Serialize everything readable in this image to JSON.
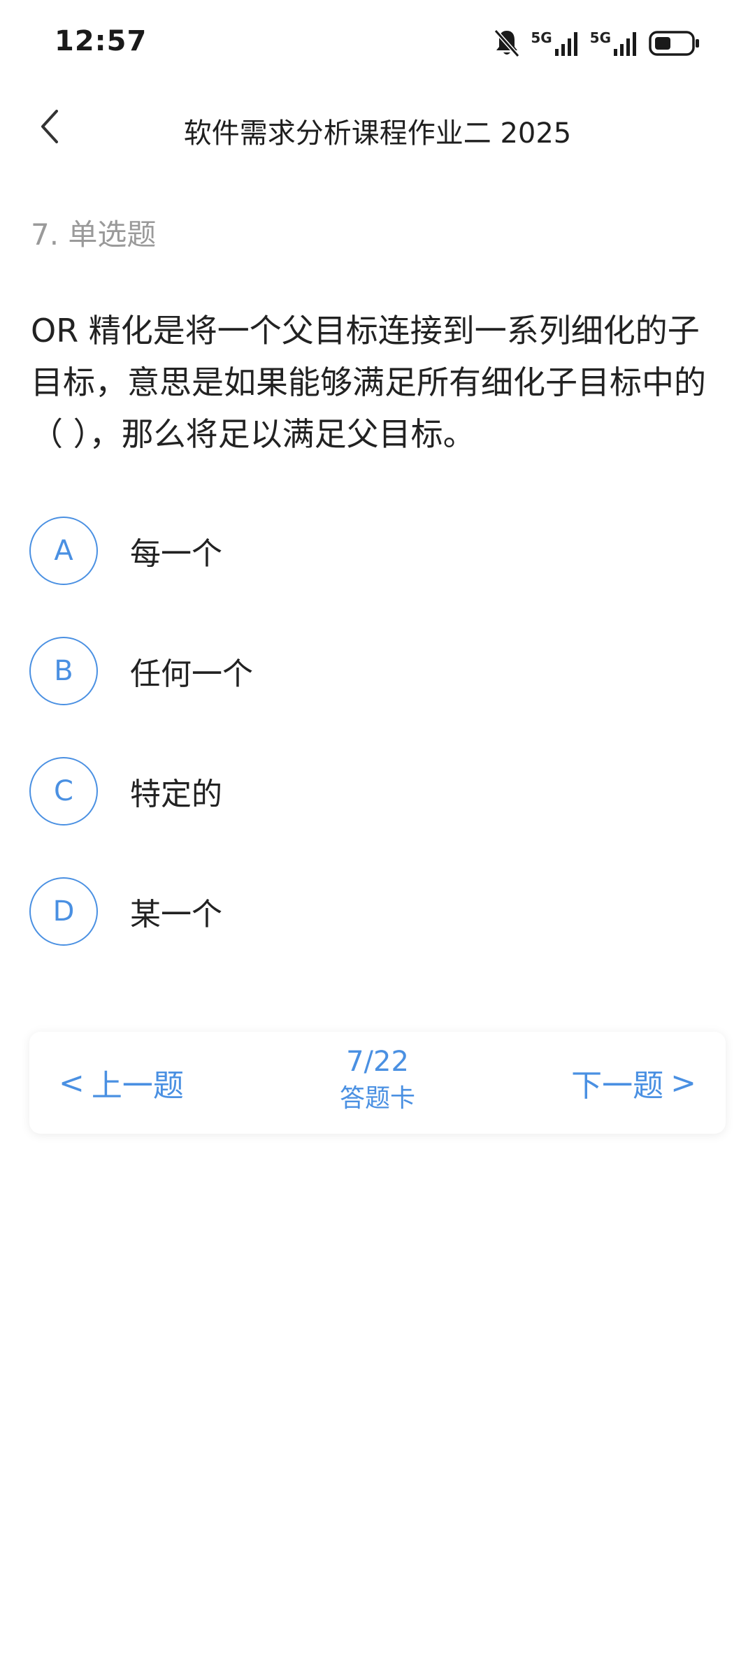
{
  "status_bar": {
    "time": "12:57",
    "icons": [
      "bell-muted-icon",
      "5g-signal-icon",
      "5g-signal-icon",
      "battery-icon"
    ],
    "network_label_1": "5G",
    "network_label_2": "5G"
  },
  "header": {
    "title": "软件需求分析课程作业二 2025",
    "back_icon": "chevron-left-icon"
  },
  "question": {
    "type_label": "7. 单选题",
    "text": "OR 精化是将一个父目标连接到一系列细化的子目标，意思是如果能够满足所有细化子目标中的（ ），那么将足以满足父目标。"
  },
  "options": [
    {
      "letter": "A",
      "text": "每一个"
    },
    {
      "letter": "B",
      "text": "任何一个"
    },
    {
      "letter": "C",
      "text": "特定的"
    },
    {
      "letter": "D",
      "text": "某一个"
    }
  ],
  "navigation": {
    "prev_arrow": "<",
    "prev_label": "上一题",
    "progress": "7/22",
    "card_label": "答题卡",
    "next_label": "下一题",
    "next_arrow": ">"
  },
  "colors": {
    "accent": "#4a90e2",
    "muted_text": "#9a9a9a",
    "body_text": "#222222"
  }
}
